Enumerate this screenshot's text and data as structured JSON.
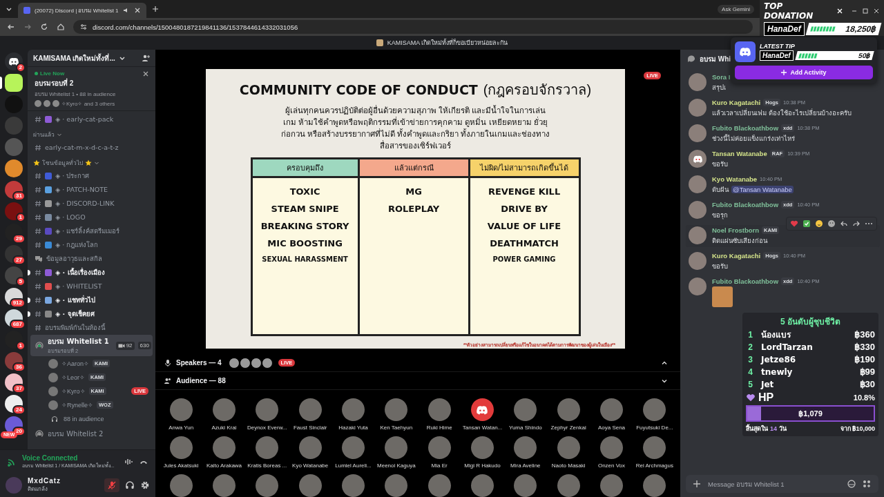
{
  "browser": {
    "tab_title": "(20072) Discord | อบรม Whitelist 1",
    "url": "discord.com/channels/1500480187219841136/1537844614332031056",
    "ask": "Ask Gemini"
  },
  "donation_widget": {
    "heading": "TOP DONATION",
    "name": "HanaDef",
    "amount": "18,250฿"
  },
  "app_title": "KAMISAMA เกิดใหม่ทั้งที่ก็ขอเบียวหน่อยละกัน",
  "servers": [
    {
      "kind": "home",
      "badge": "2",
      "selected": false
    },
    {
      "kind": "server",
      "selected": true
    },
    {
      "kind": "server",
      "selected": false
    },
    {
      "kind": "server",
      "selected": false
    },
    {
      "kind": "server",
      "selected": false
    },
    {
      "kind": "server",
      "selected": false
    },
    {
      "kind": "server",
      "badge": "31",
      "selected": false
    },
    {
      "kind": "server",
      "badge": "1",
      "selected": false
    },
    {
      "kind": "server",
      "badge": "29",
      "selected": false
    },
    {
      "kind": "server",
      "badge": "27",
      "selected": false
    },
    {
      "kind": "server",
      "badge": "5",
      "selected": false
    },
    {
      "kind": "server",
      "badge": "912",
      "selected": false
    },
    {
      "kind": "server",
      "badge": "687",
      "selected": false
    },
    {
      "kind": "server",
      "badge": "1",
      "selected": false
    },
    {
      "kind": "server",
      "badge": "36",
      "selected": false
    },
    {
      "kind": "server",
      "badge": "37",
      "selected": false
    },
    {
      "kind": "server",
      "badge": "24",
      "selected": false
    },
    {
      "kind": "server",
      "badge": "20",
      "label": "NEW",
      "selected": false
    }
  ],
  "server_header": "KAMISAMA เกิดใหม่ทั้งที่...",
  "live_card": {
    "label": "Live Now",
    "title": "อบรมรอบที่ 2",
    "info": "อบรม Whitelist 1 • 88 in audience",
    "people": "✧Kyro✧ and 3 others"
  },
  "channels": [
    {
      "kind": "text",
      "emoji": true,
      "name": "◈ · early-cat-pack",
      "unread": false
    },
    {
      "kind": "category",
      "name": "ผ่านแล้ว",
      "starred": false
    },
    {
      "kind": "text",
      "emoji": false,
      "name": "early-cat-m-x-d-c-a-t-z",
      "unread": false
    },
    {
      "kind": "category",
      "name": "โซนข้อมูลทั่วไป",
      "starred": true
    },
    {
      "kind": "text",
      "emoji": true,
      "name": "◈ · ประกาศ",
      "unread": false
    },
    {
      "kind": "text",
      "emoji": true,
      "name": "◈ · PATCH-NOTE",
      "unread": false
    },
    {
      "kind": "text",
      "emoji": true,
      "name": "◈ · DISCORD-LINK",
      "unread": false
    },
    {
      "kind": "text",
      "emoji": true,
      "name": "◈ · LOGO",
      "unread": false
    },
    {
      "kind": "text",
      "emoji": true,
      "name": "◈ · แชร์ลิ้งค์สตรีมเมอร์",
      "unread": false
    },
    {
      "kind": "text",
      "emoji": true,
      "name": "◈ · กฎแห่งโลก",
      "unread": false
    },
    {
      "kind": "forum",
      "name": "ข้อมูลอาวุธและสกิล"
    },
    {
      "kind": "text",
      "emoji": true,
      "name": "◈ · เนื้อเรื่องเมือง",
      "unread": true
    },
    {
      "kind": "text",
      "emoji": true,
      "name": "◈ · WHITELIST",
      "unread": false
    },
    {
      "kind": "text",
      "emoji": true,
      "name": "◈ · แชททั่วไป",
      "unread": true
    },
    {
      "kind": "text",
      "emoji": true,
      "name": "◈ · จุดเช็คยศ",
      "unread": true
    },
    {
      "kind": "text",
      "emoji": false,
      "name": "อบรมพิมพ์กันในห้องนี้",
      "unread": false
    },
    {
      "kind": "stage",
      "name": "อบรม Whitelist 1",
      "topic": "อบรมรอบที่ 2",
      "video": "92",
      "count": "630",
      "selected": true
    },
    {
      "kind": "member",
      "name": "✧Aaron✧",
      "tag": "KAMI"
    },
    {
      "kind": "member",
      "name": "✧Leor✧",
      "tag": "KAMI"
    },
    {
      "kind": "member",
      "name": "✧Kyro✧",
      "tag": "KAMI",
      "live_label": "LIVE"
    },
    {
      "kind": "member",
      "name": "✧Rynelle✧",
      "tag": "WOZ"
    },
    {
      "kind": "audience",
      "name": "88 in audience"
    },
    {
      "kind": "stage",
      "name": "อบรม Whitelist 2",
      "selected": false
    }
  ],
  "voice": {
    "status": "Voice Connected",
    "where": "อบรม Whitelist 1 / KAMISAMA เกิดใหม่ทั้ง..."
  },
  "user": {
    "name": "MxdCatz",
    "status": "ติดแกล้ง",
    "muted": true
  },
  "slide": {
    "title": "COMMUNITY CODE OF CONDUCT",
    "title_thai": "(กฎครอบจักรวาล)",
    "paragraph": "ผู้เล่นทุกคนควรปฏิบัติต่อผู้อื่นด้วยความสุภาพ ให้เกียรติ และมีน้ำใจในการเล่นเกม ห้ามใช้คำพูดหรือพฤติกรรมที่เข้าข่ายการคุกคาม ดูหมิ่น เหยียดหยาม ยั่วยุ ก่อกวน หรือสร้างบรรยากาศที่ไม่ดี ทั้งคำพูดและกริยา ทั้งภายในเกมและช่องทางสื่อสารของเซิร์ฟเวอร์",
    "columns": [
      {
        "heading": "ครอบคุมถึง",
        "color": "#9ed8bf",
        "items": [
          "TOXIC",
          "STEAM SNIPE",
          "BREAKING STORY",
          "MIC BOOSTING",
          "SEXUAL HARASSMENT"
        ]
      },
      {
        "heading": "แล้วแต่กรณี",
        "color": "#f4a88c",
        "items": [
          "MG",
          "ROLEPLAY"
        ]
      },
      {
        "heading": "ไม่ผิด/ไม่สามารถเกิดขึ้นได้",
        "color": "#f6d26a",
        "items": [
          "REVENGE KILL",
          "DRIVE BY",
          "VALUE OF LIFE",
          "DEATHMATCH",
          "POWER GAMING"
        ]
      }
    ],
    "footnote": "**ตัวอย่างสามารถเปลี่ยนหรือแก้ไขในอนาคตได้ตามการพัฒนาของผู้เล่นในเมือง**"
  },
  "stage_live": "LIVE",
  "speakers": {
    "label": "Speakers — 4",
    "live_label": "LIVE"
  },
  "audience": {
    "label": "Audience — 88",
    "people": [
      {
        "name": "Anwa Yun",
        "default_avatar": false
      },
      {
        "name": "Azuki Krai",
        "default_avatar": false
      },
      {
        "name": "Deynox Everw...",
        "default_avatar": false
      },
      {
        "name": "Faust Sinclair",
        "default_avatar": false
      },
      {
        "name": "Hazaki Yuta",
        "default_avatar": false
      },
      {
        "name": "Ken Taehyun",
        "default_avatar": false
      },
      {
        "name": "Ruki Hime",
        "default_avatar": false
      },
      {
        "name": "Tansan Watan...",
        "default_avatar": true
      },
      {
        "name": "Yuma Shindo",
        "default_avatar": false
      },
      {
        "name": "Zephyr Zenkai",
        "default_avatar": false
      },
      {
        "name": "Aoya Sena",
        "default_avatar": false
      },
      {
        "name": "Fuyutsuki De...",
        "default_avatar": false
      },
      {
        "name": "Jules Akatsuki",
        "default_avatar": false
      },
      {
        "name": "Kaito Arakawa",
        "default_avatar": false
      },
      {
        "name": "Kratis Boreas ...",
        "default_avatar": false
      },
      {
        "name": "Kyo Watanabe",
        "default_avatar": false
      },
      {
        "name": "Lumiel Aureli...",
        "default_avatar": false
      },
      {
        "name": "Meenoi Kaguya",
        "default_avatar": false
      },
      {
        "name": "Mia Er",
        "default_avatar": false
      },
      {
        "name": "Migi R Hakudo",
        "default_avatar": false
      },
      {
        "name": "Mira Aveline",
        "default_avatar": false
      },
      {
        "name": "Naoto Masaki",
        "default_avatar": false
      },
      {
        "name": "Onzen Vox",
        "default_avatar": false
      },
      {
        "name": "Rei Archmagus",
        "default_avatar": false
      },
      {
        "default_avatar": false
      },
      {
        "default_avatar": false
      },
      {
        "default_avatar": false
      },
      {
        "default_avatar": false
      },
      {
        "default_avatar": false
      },
      {
        "default_avatar": false
      },
      {
        "default_avatar": false
      },
      {
        "default_avatar": false
      },
      {
        "default_avatar": false
      },
      {
        "default_avatar": false
      },
      {
        "default_avatar": false
      },
      {
        "default_avatar": false
      }
    ]
  },
  "chat": {
    "header": "อบรม Whi",
    "placeholder": "Message อบรม Whitelist 1",
    "messages": [
      {
        "kind": "text",
        "default_avatar": false,
        "name": "Sora I",
        "color": "#7fbf99",
        "text": "สรุปเ",
        "hovered": false
      },
      {
        "kind": "text",
        "default_avatar": false,
        "name": "Kuro Kagatachi",
        "color": "#d4e38a",
        "tag": "Hogs",
        "time": "10:38 PM",
        "text": "แล้วเวลาเปลี่ยนเฟม ต้องใช้อะไรเปลี่ยนบ้างอะครับ",
        "hovered": false
      },
      {
        "kind": "text",
        "default_avatar": false,
        "name": "Fubito Blackoathbow",
        "color": "#7fbf99",
        "tag": "xdd",
        "time": "10:38 PM",
        "text": "ช่วงนี้ไม่ค่อยแข็งแกร่งเท่าไหร่",
        "hovered": false
      },
      {
        "kind": "text",
        "default_avatar": true,
        "name": "Tansan Watanabe",
        "color": "#d4e38a",
        "tag": "RAF",
        "time": "10:39 PM",
        "text": "ขอรับ",
        "hovered": false
      },
      {
        "kind": "text",
        "default_avatar": false,
        "name": "Kyo Watanabe",
        "color": "#d4e38a",
        "time": "10:40 PM",
        "text": "ดับฝัน",
        "mention": "@Tansan Watanabe",
        "hovered": false
      },
      {
        "kind": "text",
        "default_avatar": false,
        "name": "Fubito Blackoathbow",
        "color": "#7fbf99",
        "tag": "xdd",
        "time": "10:40 PM",
        "text": "ขอรุก",
        "hovered": false
      },
      {
        "kind": "text",
        "default_avatar": false,
        "name": "Noel Frostborn",
        "color": "#7fbf99",
        "tag": "KAMI",
        "text": "ติดแผ่นซับเสียงก่อน",
        "hovered": true
      },
      {
        "kind": "text",
        "default_avatar": false,
        "name": "Kuro Kagatachi",
        "color": "#d4e38a",
        "tag": "Hogs",
        "time": "10:40 PM",
        "text": "ขอรับ",
        "hovered": false
      },
      {
        "kind": "image",
        "default_avatar": false,
        "name": "Fubito Blackoathbow",
        "color": "#7fbf99",
        "tag": "xdd",
        "time": "10:40 PM",
        "hovered": false
      }
    ]
  },
  "leaderboard": {
    "title": "5 อันดับผู้ชุบชีวิต",
    "rows": [
      {
        "rank": "1",
        "name": "น้องแบร",
        "amount": "฿360"
      },
      {
        "rank": "2",
        "name": "LordTarzan",
        "amount": "฿330"
      },
      {
        "rank": "3",
        "name": "Jetze86",
        "amount": "฿190"
      },
      {
        "rank": "4",
        "name": "tnewly",
        "amount": "฿99"
      },
      {
        "rank": "5",
        "name": "Jet",
        "amount": "฿30"
      }
    ]
  },
  "goal": {
    "label": "HP",
    "percent": "10.8%",
    "level": 0.108,
    "amount": "฿1,079",
    "ends_prefix": "สิ้นสุดใน",
    "ends_days": "14",
    "ends_suffix": "วัน",
    "target": "จาก ฿10,000"
  },
  "popup": {
    "tip_heading": "LATEST TIP",
    "tip_name": "HanaDef",
    "tip_amount": "50฿",
    "button": "Add Activity"
  }
}
